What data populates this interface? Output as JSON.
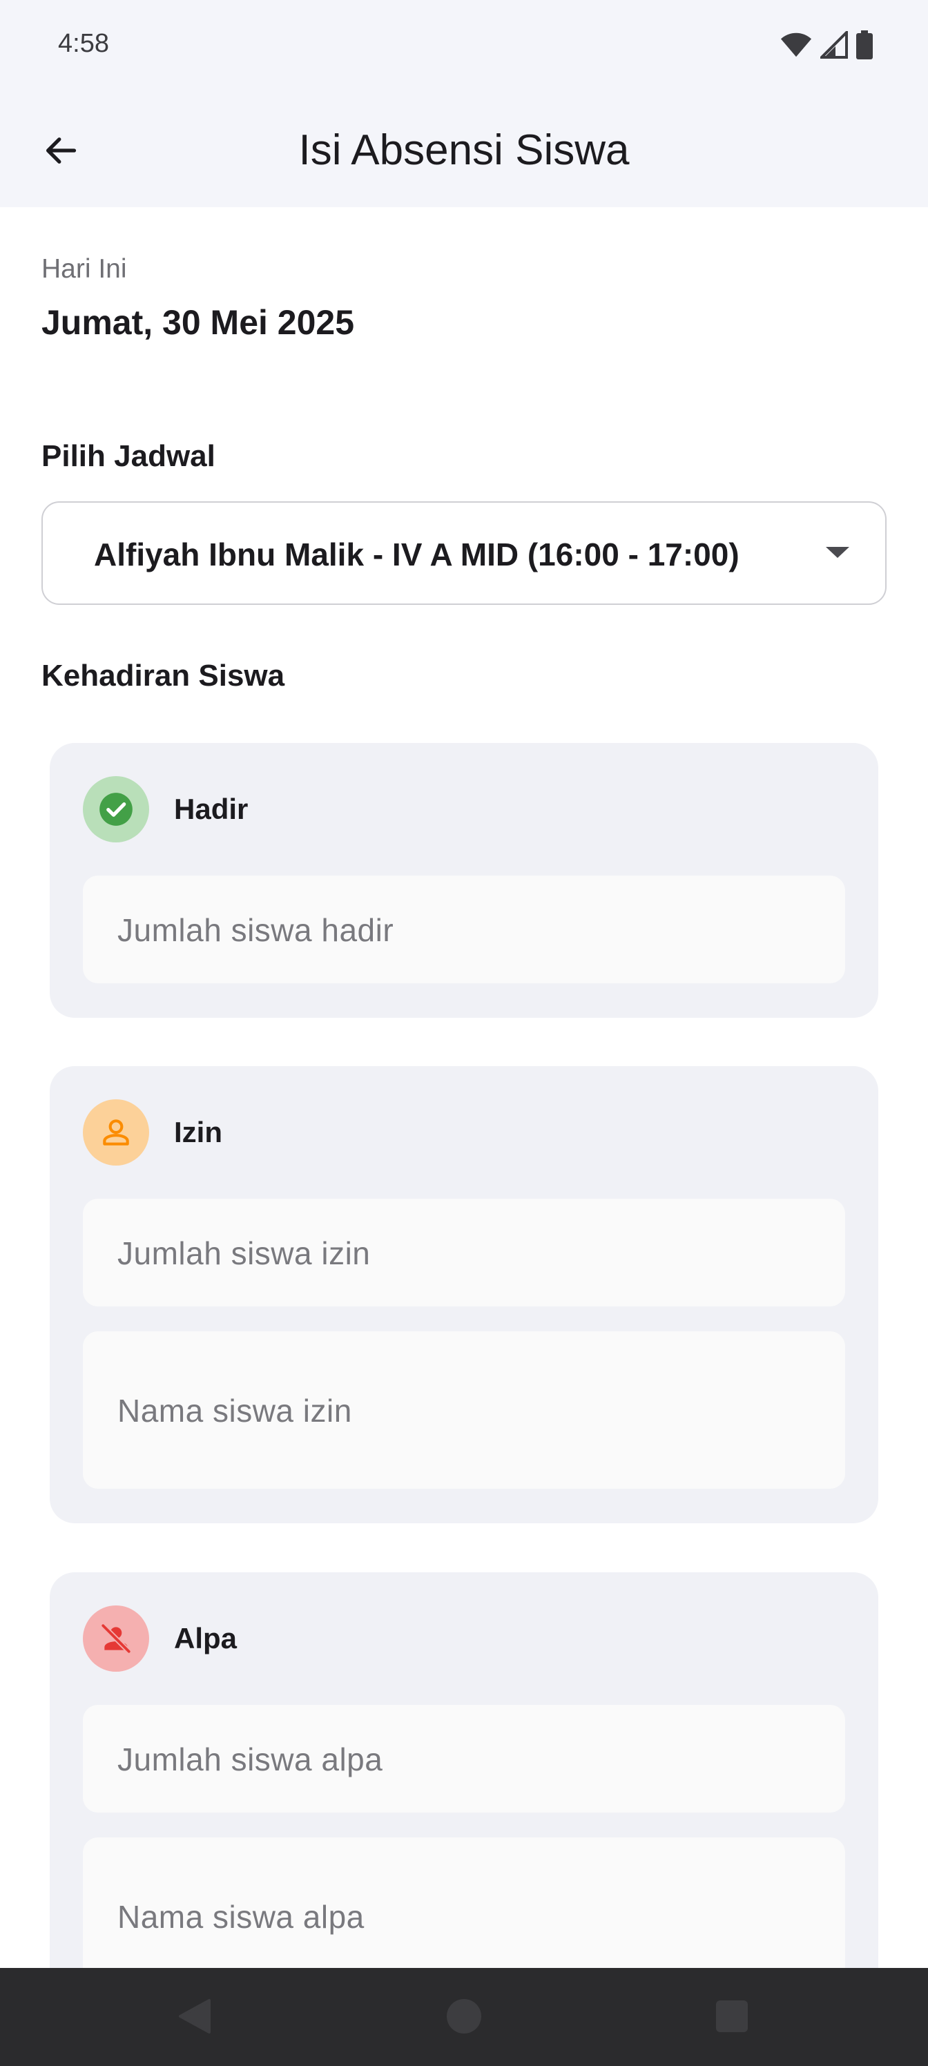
{
  "status_bar": {
    "time": "4:58"
  },
  "app_bar": {
    "title": "Isi Absensi Siswa"
  },
  "today": {
    "label": "Hari Ini",
    "date": "Jumat, 30 Mei 2025"
  },
  "schedule": {
    "label": "Pilih Jadwal",
    "selected": "Alfiyah Ibnu Malik - IV A MID (16:00 - 17:00)"
  },
  "attendance": {
    "label": "Kehadiran Siswa",
    "hadir": {
      "title": "Hadir",
      "icon": "check-circle-icon",
      "color": "#43a047",
      "count_placeholder": "Jumlah siswa hadir"
    },
    "izin": {
      "title": "Izin",
      "icon": "person-icon",
      "color": "#fb8c00",
      "count_placeholder": "Jumlah siswa izin",
      "names_placeholder": "Nama siswa izin"
    },
    "alpa": {
      "title": "Alpa",
      "icon": "person-off-icon",
      "color": "#e53935",
      "count_placeholder": "Jumlah siswa alpa",
      "names_placeholder": "Nama siswa alpa"
    }
  }
}
